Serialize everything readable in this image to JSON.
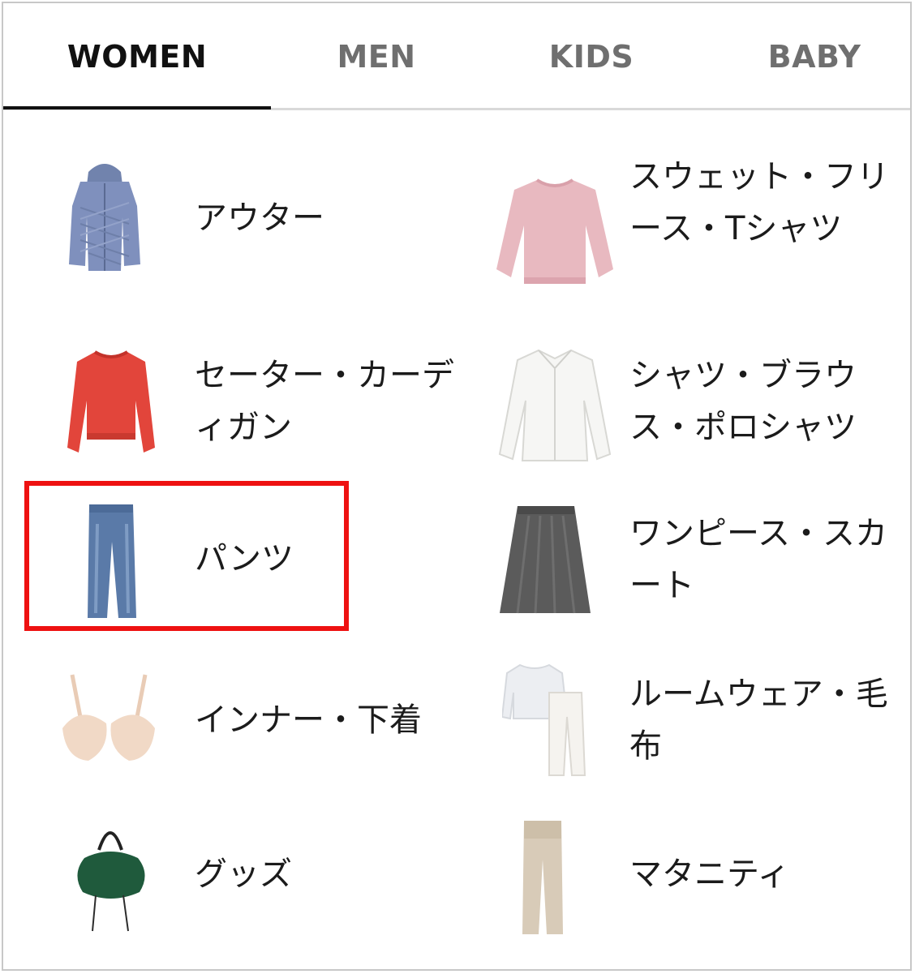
{
  "tabs": [
    {
      "label": "WOMEN",
      "active": true
    },
    {
      "label": "MEN",
      "active": false
    },
    {
      "label": "KIDS",
      "active": false
    },
    {
      "label": "BABY",
      "active": false
    }
  ],
  "categories": [
    {
      "label": "アウター",
      "icon": "down-jacket-icon"
    },
    {
      "label": "スウェット・フリース・Tシャツ",
      "icon": "sweatshirt-icon"
    },
    {
      "label": "セーター・カーディガン",
      "icon": "sweater-icon"
    },
    {
      "label": "シャツ・ブラウス・ポロシャツ",
      "icon": "blouse-icon"
    },
    {
      "label": "パンツ",
      "icon": "jeans-icon"
    },
    {
      "label": "ワンピース・スカート",
      "icon": "skirt-icon"
    },
    {
      "label": "インナー・下着",
      "icon": "bra-icon"
    },
    {
      "label": "ルームウェア・毛布",
      "icon": "loungewear-icon"
    },
    {
      "label": "グッズ",
      "icon": "bag-icon"
    },
    {
      "label": "マタニティ",
      "icon": "maternity-pants-icon"
    }
  ],
  "highlighted_category": "パンツ",
  "colors": {
    "active_tab": "#111111",
    "inactive_tab": "#6f6f6f",
    "highlight_border": "#ee1111",
    "jacket": "#7f90bd",
    "sweatshirt": "#e8b9c0",
    "sweater": "#e2453b",
    "jeans": "#5a7aa8",
    "skirt": "#5b5b5b",
    "bra": "#f1d9c6",
    "bag": "#1f5a3c",
    "maternity": "#d8cbb8"
  }
}
